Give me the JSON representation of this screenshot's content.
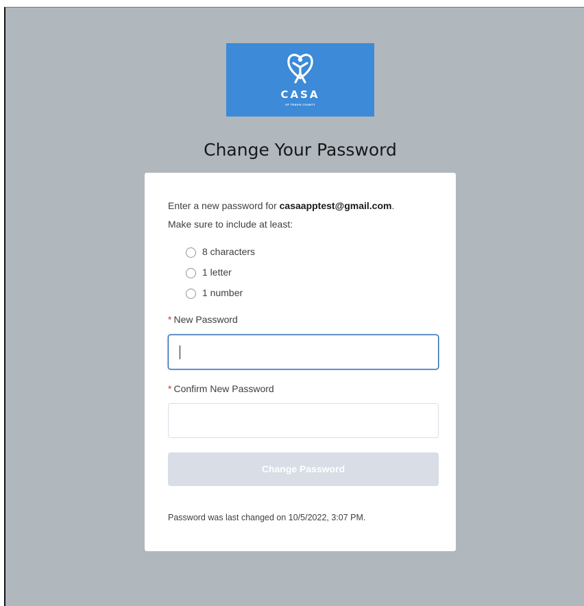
{
  "brand": {
    "name": "CASA",
    "subtitle": "OF TRAVIS COUNTY",
    "logo_icon": "heart-child-icon",
    "logo_bg": "#3c8ad8"
  },
  "page": {
    "title": "Change Your Password"
  },
  "form": {
    "intro_text": "Enter a new password for ",
    "email": "casaapptest@gmail.com",
    "intro_end": ".",
    "include_label": "Make sure to include at least:",
    "requirements": [
      {
        "label": "8 characters",
        "met": false
      },
      {
        "label": "1 letter",
        "met": false
      },
      {
        "label": "1 number",
        "met": false
      }
    ],
    "required_mark": "*",
    "new_password_label": "New Password",
    "new_password_value": "",
    "confirm_password_label": "Confirm New Password",
    "confirm_password_value": "",
    "submit_label": "Change Password",
    "submit_enabled": false,
    "last_changed": "Password was last changed on 10/5/2022, 3:07 PM."
  },
  "colors": {
    "background": "#b0b7bd",
    "required": "#c23934",
    "focus_border": "#1b5fa8",
    "disabled_button": "#d8dde6"
  }
}
